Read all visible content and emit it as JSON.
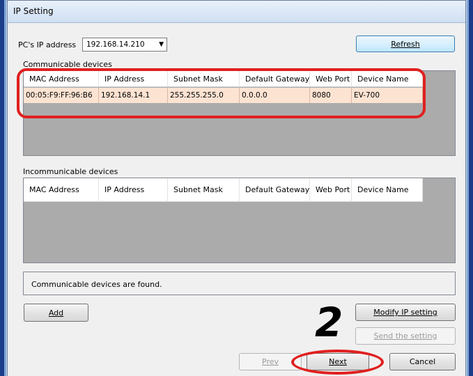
{
  "window": {
    "title": "IP Setting"
  },
  "pc_ip": {
    "label": "PC's IP address",
    "value": "192.168.14.210"
  },
  "buttons": {
    "refresh": "Refresh",
    "add": "Add",
    "modify": "Modify IP setting",
    "send": "Send the setting",
    "prev": "Prev",
    "next": "Next",
    "cancel": "Cancel"
  },
  "communicable": {
    "label": "Communicable devices",
    "columns": [
      "MAC Address",
      "IP Address",
      "Subnet Mask",
      "Default Gateway",
      "Web Port",
      "Device Name"
    ],
    "rows": [
      [
        "00:05:F9:FF:96:B6",
        "192.168.14.1",
        "255.255.255.0",
        "0.0.0.0",
        "8080",
        "EV-700"
      ]
    ]
  },
  "incommunicable": {
    "label": "Incommunicable devices",
    "columns": [
      "MAC Address",
      "IP Address",
      "Subnet Mask",
      "Default Gateway",
      "Web Port",
      "Device Name"
    ],
    "rows": []
  },
  "status": "Communicable devices are found.",
  "annotation": {
    "step": "2",
    "color": "#e0201f"
  }
}
